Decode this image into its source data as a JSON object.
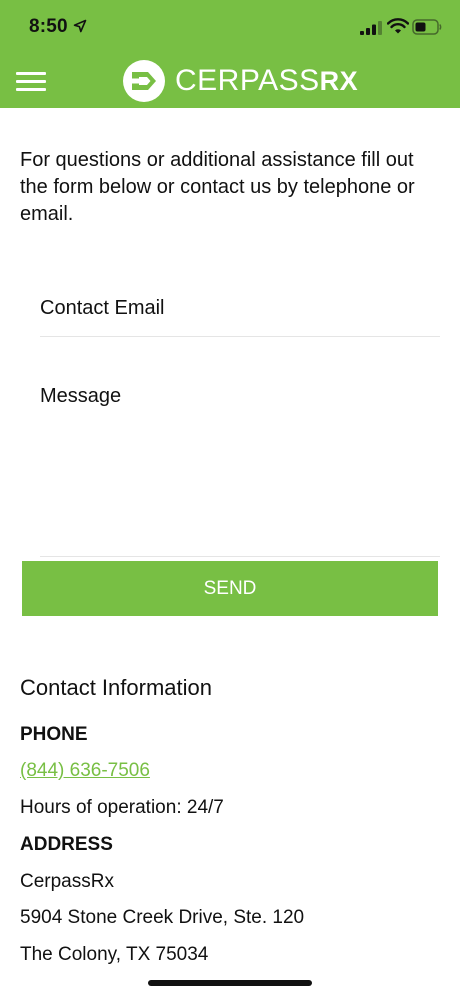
{
  "status_bar": {
    "time": "8:50"
  },
  "header": {
    "brand_main": "CERPASS",
    "brand_suffix": "RX",
    "icons": {
      "menu": "hamburger-menu-icon",
      "logo": "cerpass-logo-icon"
    }
  },
  "intro": {
    "text": "For questions or additional assistance fill out the form below or contact us by telephone or email."
  },
  "form": {
    "email_label": "Contact Email",
    "message_label": "Message",
    "send_label": "SEND"
  },
  "contact": {
    "title": "Contact Information",
    "phone_heading": "PHONE",
    "phone_number": "(844) 636-7506",
    "hours": "Hours of operation: 24/7",
    "address_heading": "ADDRESS",
    "address_line1": "CerpassRx",
    "address_line2": "5904 Stone Creek Drive, Ste. 120",
    "address_line3": "The Colony, TX 75034"
  },
  "colors": {
    "brand_green": "#78bf44",
    "text": "#111111",
    "divider": "#e5e5e5"
  }
}
